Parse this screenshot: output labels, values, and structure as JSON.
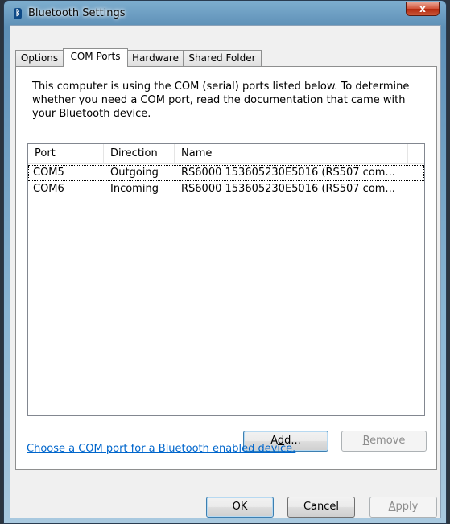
{
  "window": {
    "title": "Bluetooth Settings",
    "close_symbol": "x"
  },
  "tabs": [
    {
      "label": "Options",
      "active": false
    },
    {
      "label": "COM Ports",
      "active": true
    },
    {
      "label": "Hardware",
      "active": false
    },
    {
      "label": "Shared Folder",
      "active": false
    }
  ],
  "description": "This computer is using the COM (serial) ports listed below. To determine whether you need a COM port, read the documentation that came with your Bluetooth device.",
  "ports_list": {
    "columns": [
      "Port",
      "Direction",
      "Name"
    ],
    "rows": [
      {
        "port": "COM5",
        "direction": "Outgoing",
        "name": "RS6000 153605230E5016  (RS507 com..."
      },
      {
        "port": "COM6",
        "direction": "Incoming",
        "name": "RS6000 153605230E5016  (RS507 com..."
      }
    ]
  },
  "buttons": {
    "add": {
      "pre": "A",
      "mnemonic": "d",
      "post": "d..."
    },
    "remove": {
      "mnemonic": "R",
      "post": "emove"
    },
    "ok": "OK",
    "cancel": "Cancel",
    "apply": {
      "mnemonic": "A",
      "post": "pply"
    }
  },
  "link_text": "Choose a COM port for a Bluetooth enabled device.",
  "colors": {
    "link": "#0066cc",
    "title_bar": "#7eaecf"
  }
}
